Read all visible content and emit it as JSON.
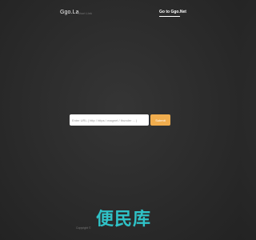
{
  "header": {
    "brand": "Ggo.La",
    "tagline": "Short Link",
    "nav_link": "Go to Ggo.Net"
  },
  "form": {
    "placeholder": "Enter URL ( http / https / magnet / thunder ... )",
    "value": "",
    "submit_label": "Submit"
  },
  "footer": {
    "copyright": "Copyright ©"
  },
  "watermark": {
    "text": "便民库"
  },
  "colors": {
    "background": "#2d2d2d",
    "accent": "#f0ad4e",
    "watermark": "#2fc2c7"
  }
}
